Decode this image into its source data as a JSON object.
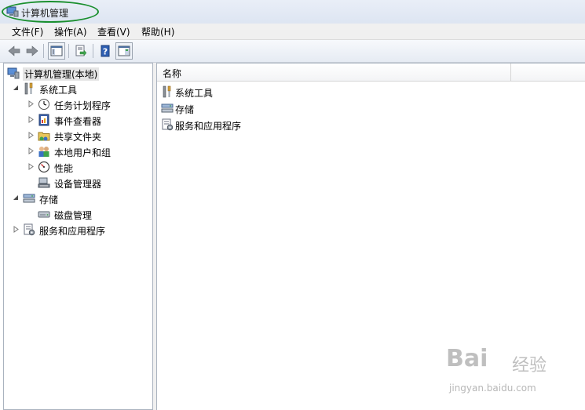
{
  "window": {
    "title": "计算机管理"
  },
  "menu": [
    {
      "label": "文件(F)"
    },
    {
      "label": "操作(A)"
    },
    {
      "label": "查看(V)"
    },
    {
      "label": "帮助(H)"
    }
  ],
  "toolbar": {
    "buttons": [
      "back-arrow-icon",
      "forward-arrow-icon",
      "show-hide-tree-icon",
      "export-list-icon",
      "help-icon",
      "action-pane-icon"
    ]
  },
  "tree": {
    "root": "计算机管理(本地)",
    "system_tools": "系统工具",
    "task_scheduler": "任务计划程序",
    "event_viewer": "事件查看器",
    "shared_folders": "共享文件夹",
    "local_users": "本地用户和组",
    "performance": "性能",
    "device_manager": "设备管理器",
    "storage": "存储",
    "disk_management": "磁盘管理",
    "services_apps": "服务和应用程序"
  },
  "list": {
    "column_name": "名称",
    "items": [
      "系统工具",
      "存储",
      "服务和应用程序"
    ]
  },
  "watermark": {
    "brand": "Bai",
    "brand2": "经验",
    "url": "jingyan.baidu.com"
  }
}
